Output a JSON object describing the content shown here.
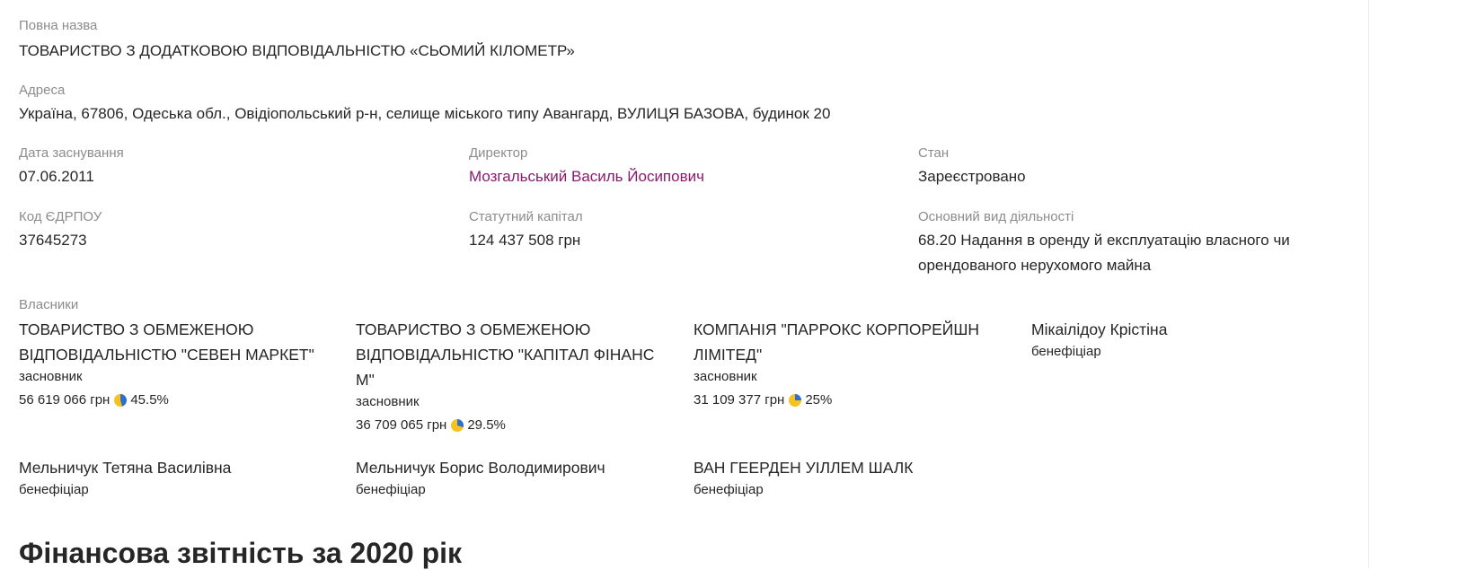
{
  "company": {
    "full_name_label": "Повна назва",
    "full_name": "ТОВАРИСТВО З ДОДАТКОВОЮ ВІДПОВІДАЛЬНІСТЮ «СЬОМИЙ КІЛОМЕТР»",
    "address_label": "Адреса",
    "address": "Україна, 67806, Одеська обл., Овідіопольський р-н, селище міського типу Авангард, ВУЛИЦЯ БАЗОВА, будинок 20",
    "founded_label": "Дата заснування",
    "founded": "07.06.2011",
    "director_label": "Директор",
    "director": "Мозгальський Василь Йосипович",
    "status_label": "Стан",
    "status": "Зареєстровано",
    "edrpou_label": "Код ЄДРПОУ",
    "edrpou": "37645273",
    "capital_label": "Статутний капітал",
    "capital": "124 437 508 грн",
    "activity_label": "Основний вид діяльності",
    "activity": "68.20 Надання в оренду й експлуатацію власного чи орендованого нерухомого майна"
  },
  "owners": {
    "label": "Власники",
    "items": [
      {
        "name": "ТОВАРИСТВО З ОБМЕЖЕНОЮ ВІДПОВІДАЛЬНІСТЮ \"СЕВЕН МАРКЕТ\"",
        "role": "засновник",
        "amount": "56 619 066 грн",
        "percent": "45.5%",
        "share": 0.455
      },
      {
        "name": "ТОВАРИСТВО З ОБМЕЖЕНОЮ ВІДПОВІДАЛЬНІСТЮ \"КАПІТАЛ ФІНАНС М\"",
        "role": "засновник",
        "amount": "36 709 065 грн",
        "percent": "29.5%",
        "share": 0.295
      },
      {
        "name": "КОМПАНІЯ \"ПАРРОКС КОРПОРЕЙШН ЛІМІТЕД\"",
        "role": "засновник",
        "amount": "31 109 377 грн",
        "percent": "25%",
        "share": 0.25
      },
      {
        "name": "Мікаілідоу Крістіна",
        "role": "бенефіціар"
      },
      {
        "name": "Мельничук Тетяна Василівна",
        "role": "бенефіціар"
      },
      {
        "name": "Мельничук Борис Володимирович",
        "role": "бенефіціар"
      },
      {
        "name": "ВАН ГЕЕРДЕН УІЛЛЕМ ШАЛК",
        "role": "бенефіціар"
      }
    ]
  },
  "section_heading": "Фінансова звітність за 2020 рік",
  "colors": {
    "pie_blue": "#2d6fd6",
    "pie_yellow": "#f7c21a",
    "link_purple": "#8a1a6e",
    "link_blue": "#2f6ed1"
  }
}
